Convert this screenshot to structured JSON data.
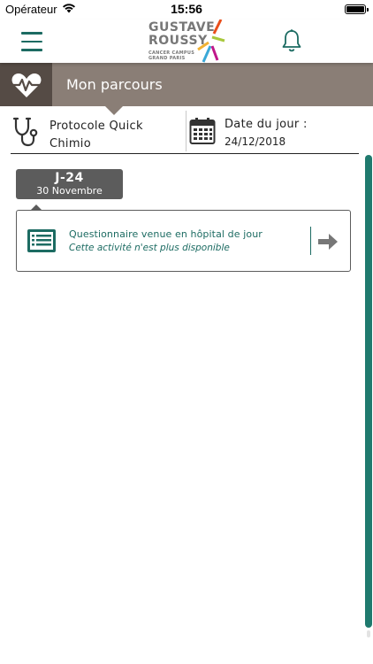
{
  "status_bar": {
    "carrier": "Opérateur",
    "time": "15:56"
  },
  "header": {
    "logo": {
      "line1": "GUSTAVE",
      "line2": "ROUSSY",
      "sub1": "CANCER CAMPUS",
      "sub2": "GRAND PARIS"
    },
    "menu_icon": "hamburger-menu-icon",
    "bell_icon": "bell-icon"
  },
  "banner": {
    "title": "Mon parcours",
    "icon": "heart-pulse-icon"
  },
  "info": {
    "protocol_label": "Protocole Quick Chimio",
    "date_label": "Date du jour :",
    "date_value": "24/12/2018"
  },
  "timeline": {
    "day_label": "J-24",
    "day_date": "30 Novembre",
    "activity": {
      "title": "Questionnaire venue en hôpital de jour",
      "status": "Cette activité n'est plus disponible"
    }
  },
  "colors": {
    "accent": "#1c6b62",
    "banner": "#8a7e76",
    "banner_icon_bg": "#554b45",
    "badge": "#5c5c5c",
    "scrollbar": "#1f7a6e"
  }
}
